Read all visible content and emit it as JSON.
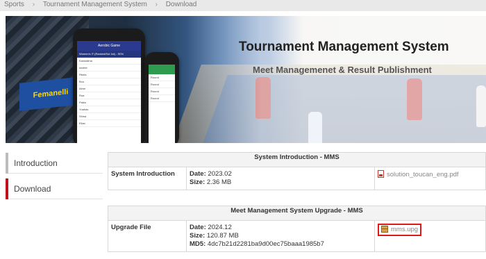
{
  "breadcrumb": [
    "Sports",
    "Tournament Management System",
    "Download"
  ],
  "banner": {
    "title": "Tournament Management System",
    "subtitle": "Meet Managemenet & Result Publishment",
    "adboard": "Femanelli",
    "phone1": {
      "app_title": "Aerobic Game",
      "app_subtitle": "Women's IT (Ranked/Sol 1st) - SEN",
      "rows": [
        "Kandalima",
        "sustee",
        "Rbeia",
        "Bou",
        "Alme",
        "Rua",
        "Pablo",
        "Yuahas",
        "Shina",
        "Ellan"
      ]
    },
    "phone2": {
      "app_title": "",
      "rows": [
        "Round",
        "Round",
        "Round",
        "Round"
      ]
    }
  },
  "sidebar": {
    "items": [
      {
        "label": "Introduction",
        "accent": "#bdbdbd"
      },
      {
        "label": "Download",
        "accent": "#c0101c"
      }
    ]
  },
  "sections": [
    {
      "header": "System Introduction - MMS",
      "label": "System Introduction",
      "date_key": "Date:",
      "date": "2023.02",
      "size_key": "Size:",
      "size": "2.36 MB",
      "file": "solution_toucan_eng.pdf",
      "file_icon": "pdf-file-icon"
    },
    {
      "header": "Meet Management System Upgrade - MMS",
      "label": "Upgrade File",
      "date_key": "Date:",
      "date": "2024.12",
      "size_key": "Size:",
      "size": "120.87 MB",
      "md5_key": "MD5:",
      "md5": "4dc7b21d2281ba9d00ec75baaa1985b7",
      "file": "mms.upg",
      "file_icon": "package-file-icon",
      "highlight_color": "#e01818"
    }
  ]
}
